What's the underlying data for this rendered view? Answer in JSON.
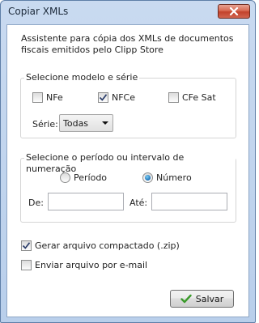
{
  "window": {
    "title": "Copiar XMLs",
    "close_icon": "close-icon"
  },
  "description": {
    "line1": "Assistente para cópia dos XMLs de documentos",
    "line2": "fiscais emitidos pelo Clipp Store"
  },
  "model_group": {
    "title": "Selecione modelo e série",
    "checkboxes": [
      {
        "label": "NFe",
        "checked": false
      },
      {
        "label": "NFCe",
        "checked": true
      },
      {
        "label": "CFe Sat",
        "checked": false
      }
    ],
    "serie_label": "Série:",
    "serie_value": "Todas"
  },
  "period_group": {
    "title": "Selecione o período ou intervalo de numeração",
    "radios": [
      {
        "label": "Período",
        "selected": false
      },
      {
        "label": "Número",
        "selected": true
      }
    ],
    "from_label": "De:",
    "from_value": "",
    "to_label": "Até:",
    "to_value": ""
  },
  "options": {
    "zip": {
      "label": "Gerar arquivo compactado (.zip)",
      "checked": true
    },
    "email": {
      "label": "Enviar arquivo por e-mail",
      "checked": false
    }
  },
  "save_button": {
    "label": "Salvar",
    "icon": "checkmark-icon",
    "icon_color": "#3a9a2a"
  }
}
